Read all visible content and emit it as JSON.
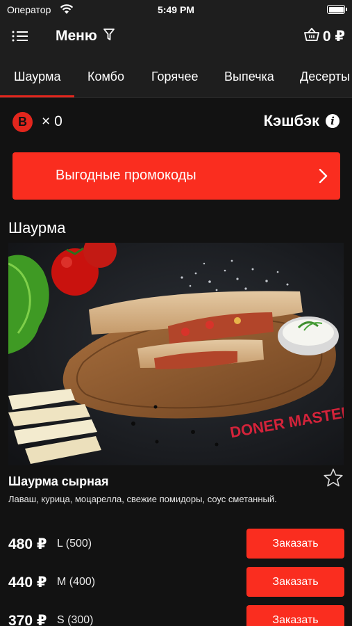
{
  "status_bar": {
    "carrier": "Оператор",
    "time": "5:49 PM"
  },
  "nav": {
    "title": "Меню",
    "cart_total": "0 ₽"
  },
  "tabs": [
    {
      "label": "Шаурма",
      "active": true
    },
    {
      "label": "Комбо"
    },
    {
      "label": "Горячее"
    },
    {
      "label": "Выпечка"
    },
    {
      "label": "Десерты"
    }
  ],
  "cashback": {
    "coin_letter": "B",
    "count": "× 0",
    "label": "Кэшбэк",
    "info_glyph": "i"
  },
  "promo": {
    "label": "Выгодные промокоды"
  },
  "section": {
    "title": "Шаурма"
  },
  "product": {
    "name": "Шаурма сырная",
    "description": "Лаваш, курица, моцарелла, свежие помидоры, соус сметанный.",
    "image_text": "DONER MASTER",
    "prices": [
      {
        "price": "480 ₽",
        "size": "L (500)",
        "button": "Заказать"
      },
      {
        "price": "440 ₽",
        "size": "M (400)",
        "button": "Заказать"
      },
      {
        "price": "370 ₽",
        "size": "S (300)",
        "button": "Заказать"
      }
    ]
  },
  "colors": {
    "accent": "#fa2d1f",
    "background": "#121212",
    "bar": "#1e1e1e"
  },
  "icons": [
    "wifi-icon",
    "battery-icon",
    "menu-list-icon",
    "filter-icon",
    "basket-icon",
    "info-icon",
    "chevron-right-icon",
    "star-icon"
  ]
}
